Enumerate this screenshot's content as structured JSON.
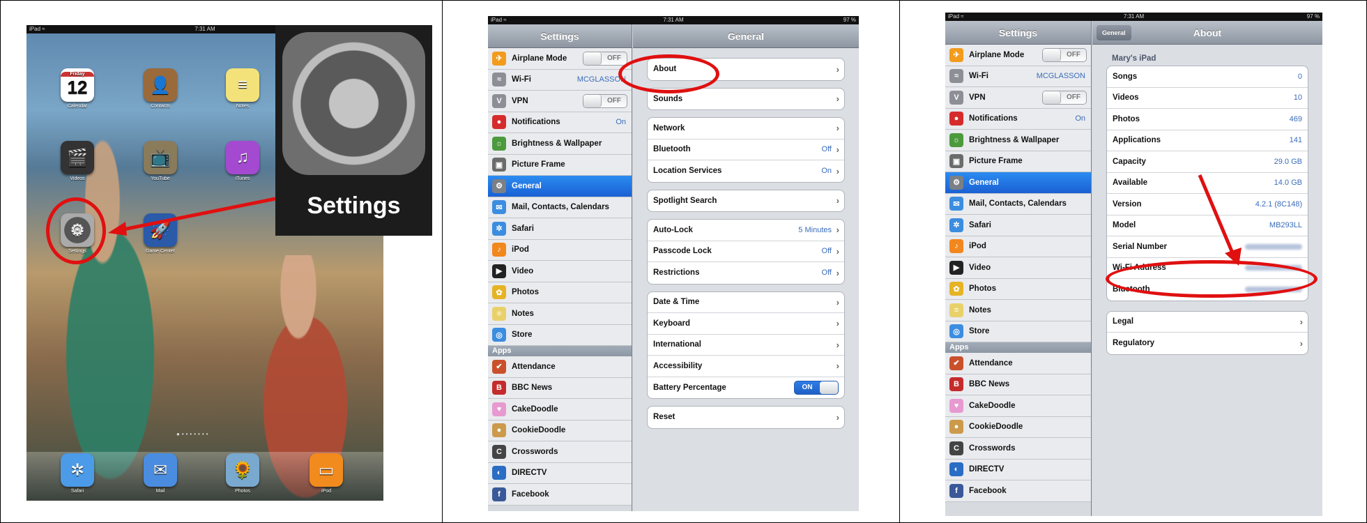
{
  "panel1": {
    "status": {
      "left": "iPad",
      "time": "7:31 AM"
    },
    "icons": [
      {
        "name": "Calendar",
        "day": "Friday",
        "date": "12"
      },
      {
        "name": "Contacts"
      },
      {
        "name": "Notes"
      },
      {
        "name": "Videos"
      },
      {
        "name": "YouTube"
      },
      {
        "name": "iTunes"
      },
      {
        "name": "Settings"
      },
      {
        "name": "Game Center"
      }
    ],
    "dock": [
      "Safari",
      "Mail",
      "Photos",
      "iPod"
    ],
    "zoom_label": "Settings",
    "colors": {
      "highlight": "#e01010"
    }
  },
  "panel2": {
    "status": {
      "left": "iPad",
      "time": "7:31 AM",
      "battery": "97 %"
    },
    "sidebar_title": "Settings",
    "detail_title": "General",
    "sidebar": [
      {
        "label": "Airplane Mode",
        "icon": "airplane-icon",
        "color": "#f29b1d",
        "toggle": "OFF"
      },
      {
        "label": "Wi-Fi",
        "icon": "wifi-icon",
        "color": "#8c8f95",
        "value": "MCGLASSON"
      },
      {
        "label": "VPN",
        "icon": "vpn-icon",
        "color": "#8c8f95",
        "toggle": "OFF"
      },
      {
        "label": "Notifications",
        "icon": "notifications-icon",
        "color": "#d62b2b",
        "value": "On"
      },
      {
        "label": "Brightness & Wallpaper",
        "icon": "brightness-icon",
        "color": "#4c9a3c"
      },
      {
        "label": "Picture Frame",
        "icon": "picture-frame-icon",
        "color": "#6b6b6b"
      },
      {
        "label": "General",
        "icon": "gear-icon",
        "color": "#7b7f86",
        "selected": true
      },
      {
        "label": "Mail, Contacts, Calendars",
        "icon": "mail-icon",
        "color": "#3b8de0"
      },
      {
        "label": "Safari",
        "icon": "safari-icon",
        "color": "#3b8de0"
      },
      {
        "label": "iPod",
        "icon": "ipod-icon",
        "color": "#f2871d"
      },
      {
        "label": "Video",
        "icon": "video-icon",
        "color": "#222"
      },
      {
        "label": "Photos",
        "icon": "photos-icon",
        "color": "#e6b325"
      },
      {
        "label": "Notes",
        "icon": "notes-icon",
        "color": "#e9d16a"
      },
      {
        "label": "Store",
        "icon": "store-icon",
        "color": "#3b8de0"
      }
    ],
    "apps_header": "Apps",
    "apps": [
      {
        "label": "Attendance",
        "icon": "attendance-icon",
        "color": "#c9502b"
      },
      {
        "label": "BBC News",
        "icon": "bbc-news-icon",
        "color": "#c42b2b"
      },
      {
        "label": "CakeDoodle",
        "icon": "cakedoodle-icon",
        "color": "#e79ad0"
      },
      {
        "label": "CookieDoodle",
        "icon": "cookiedoodle-icon",
        "color": "#cc9a4a"
      },
      {
        "label": "Crosswords",
        "icon": "crosswords-icon",
        "color": "#444"
      },
      {
        "label": "DIRECTV",
        "icon": "directv-icon",
        "color": "#2a6dc4"
      },
      {
        "label": "Facebook",
        "icon": "facebook-icon",
        "color": "#3b5998"
      }
    ],
    "groups": [
      [
        {
          "label": "About"
        }
      ],
      [
        {
          "label": "Sounds"
        }
      ],
      [
        {
          "label": "Network"
        },
        {
          "label": "Bluetooth",
          "value": "Off"
        },
        {
          "label": "Location Services",
          "value": "On"
        }
      ],
      [
        {
          "label": "Spotlight Search"
        }
      ],
      [
        {
          "label": "Auto-Lock",
          "value": "5 Minutes"
        },
        {
          "label": "Passcode Lock",
          "value": "Off"
        },
        {
          "label": "Restrictions",
          "value": "Off"
        }
      ],
      [
        {
          "label": "Date & Time"
        },
        {
          "label": "Keyboard"
        },
        {
          "label": "International"
        },
        {
          "label": "Accessibility"
        },
        {
          "label": "Battery Percentage",
          "toggle": "ON"
        }
      ],
      [
        {
          "label": "Reset"
        }
      ]
    ]
  },
  "panel3": {
    "status": {
      "left": "iPad",
      "time": "7:31 AM",
      "battery": "97 %"
    },
    "sidebar_title": "Settings",
    "back_label": "General",
    "detail_title": "About",
    "device_name": "Mary's iPad",
    "about_rows": [
      {
        "label": "Songs",
        "value": "0"
      },
      {
        "label": "Videos",
        "value": "10"
      },
      {
        "label": "Photos",
        "value": "469"
      },
      {
        "label": "Applications",
        "value": "141"
      },
      {
        "label": "Capacity",
        "value": "29.0 GB"
      },
      {
        "label": "Available",
        "value": "14.0 GB"
      },
      {
        "label": "Version",
        "value": "4.2.1 (8C148)"
      },
      {
        "label": "Model",
        "value": "MB293LL"
      },
      {
        "label": "Serial Number",
        "blurred": true
      },
      {
        "label": "Wi-Fi Address",
        "blurred": true
      },
      {
        "label": "Bluetooth",
        "blurred": true
      }
    ],
    "legal_rows": [
      {
        "label": "Legal"
      },
      {
        "label": "Regulatory"
      }
    ]
  }
}
